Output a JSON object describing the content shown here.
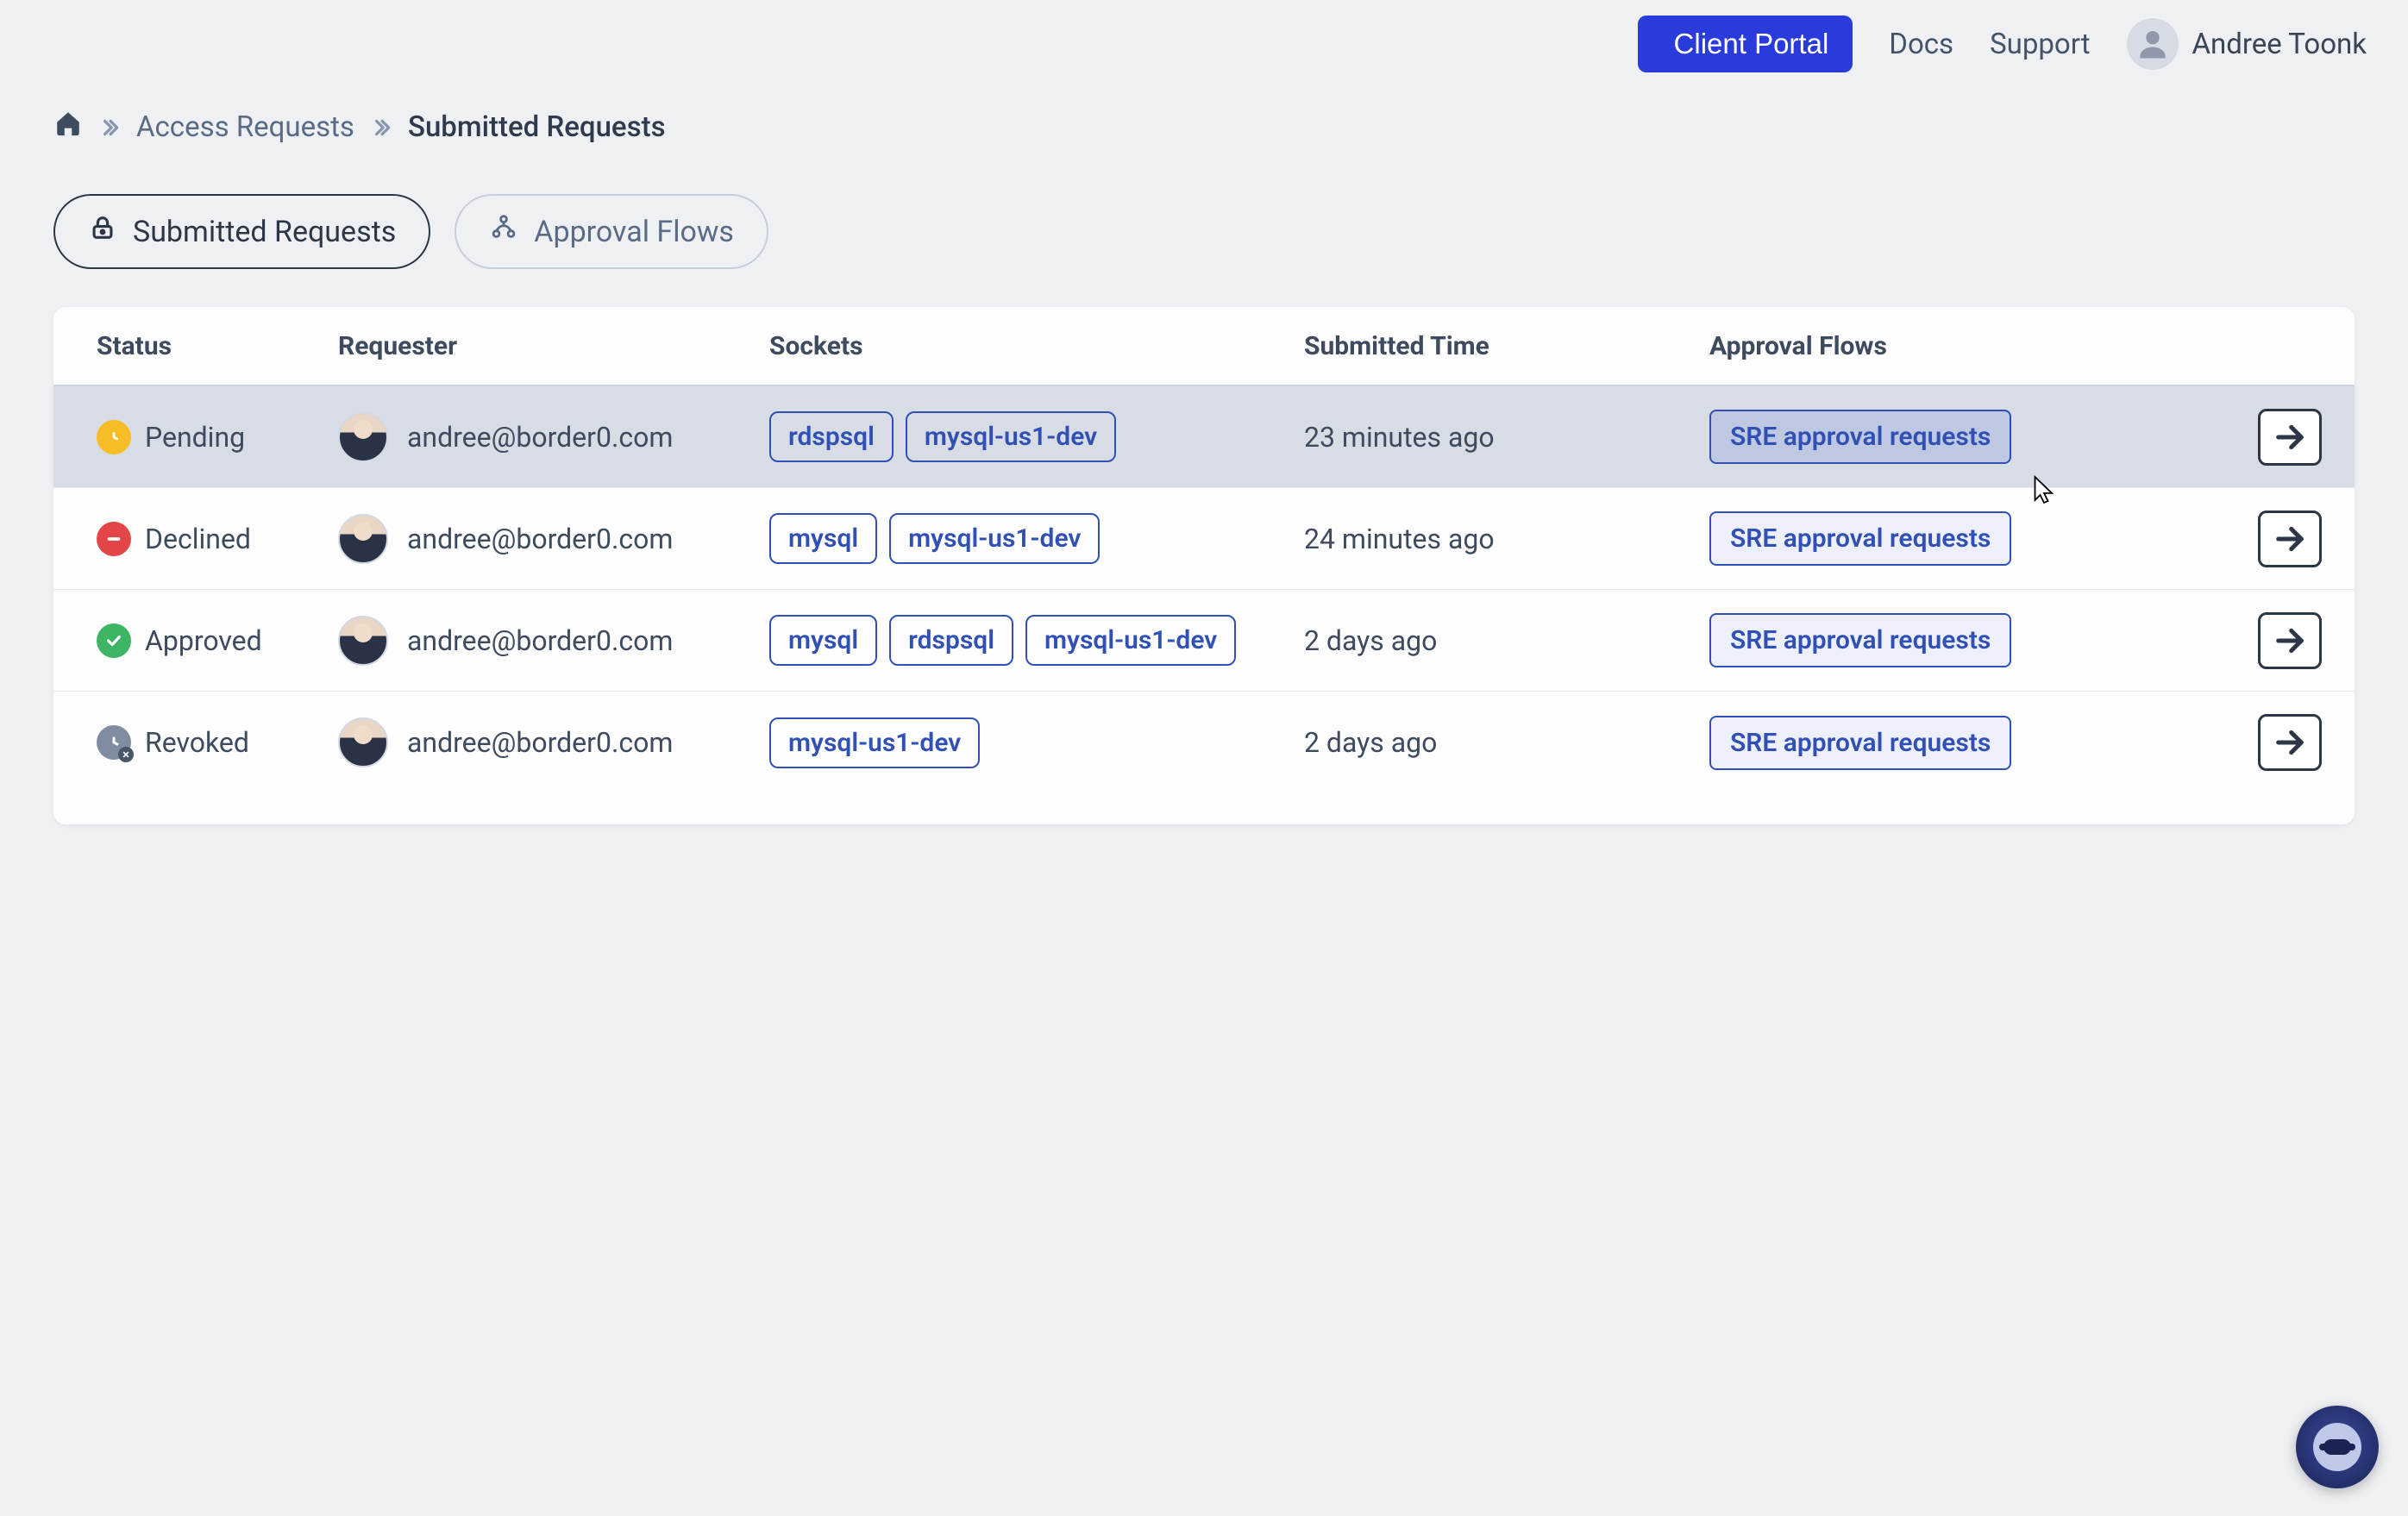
{
  "header": {
    "client_portal": "Client Portal",
    "docs": "Docs",
    "support": "Support",
    "user_name": "Andree Toonk"
  },
  "breadcrumb": {
    "link": "Access Requests",
    "current": "Submitted Requests"
  },
  "tabs": {
    "submitted": "Submitted Requests",
    "approval_flows": "Approval Flows"
  },
  "table": {
    "headers": {
      "status": "Status",
      "requester": "Requester",
      "sockets": "Sockets",
      "submitted": "Submitted Time",
      "flows": "Approval Flows"
    },
    "rows": [
      {
        "status": "Pending",
        "status_kind": "pending",
        "requester": "andree@border0.com",
        "sockets": [
          "rdspsql",
          "mysql-us1-dev"
        ],
        "submitted": "23 minutes ago",
        "flow": "SRE approval requests",
        "hovered": true
      },
      {
        "status": "Declined",
        "status_kind": "declined",
        "requester": "andree@border0.com",
        "sockets": [
          "mysql",
          "mysql-us1-dev"
        ],
        "submitted": "24 minutes ago",
        "flow": "SRE approval requests",
        "hovered": false
      },
      {
        "status": "Approved",
        "status_kind": "approved",
        "requester": "andree@border0.com",
        "sockets": [
          "mysql",
          "rdspsql",
          "mysql-us1-dev"
        ],
        "submitted": "2 days ago",
        "flow": "SRE approval requests",
        "hovered": false
      },
      {
        "status": "Revoked",
        "status_kind": "revoked",
        "requester": "andree@border0.com",
        "sockets": [
          "mysql-us1-dev"
        ],
        "submitted": "2 days ago",
        "flow": "SRE approval requests",
        "hovered": false
      }
    ]
  }
}
